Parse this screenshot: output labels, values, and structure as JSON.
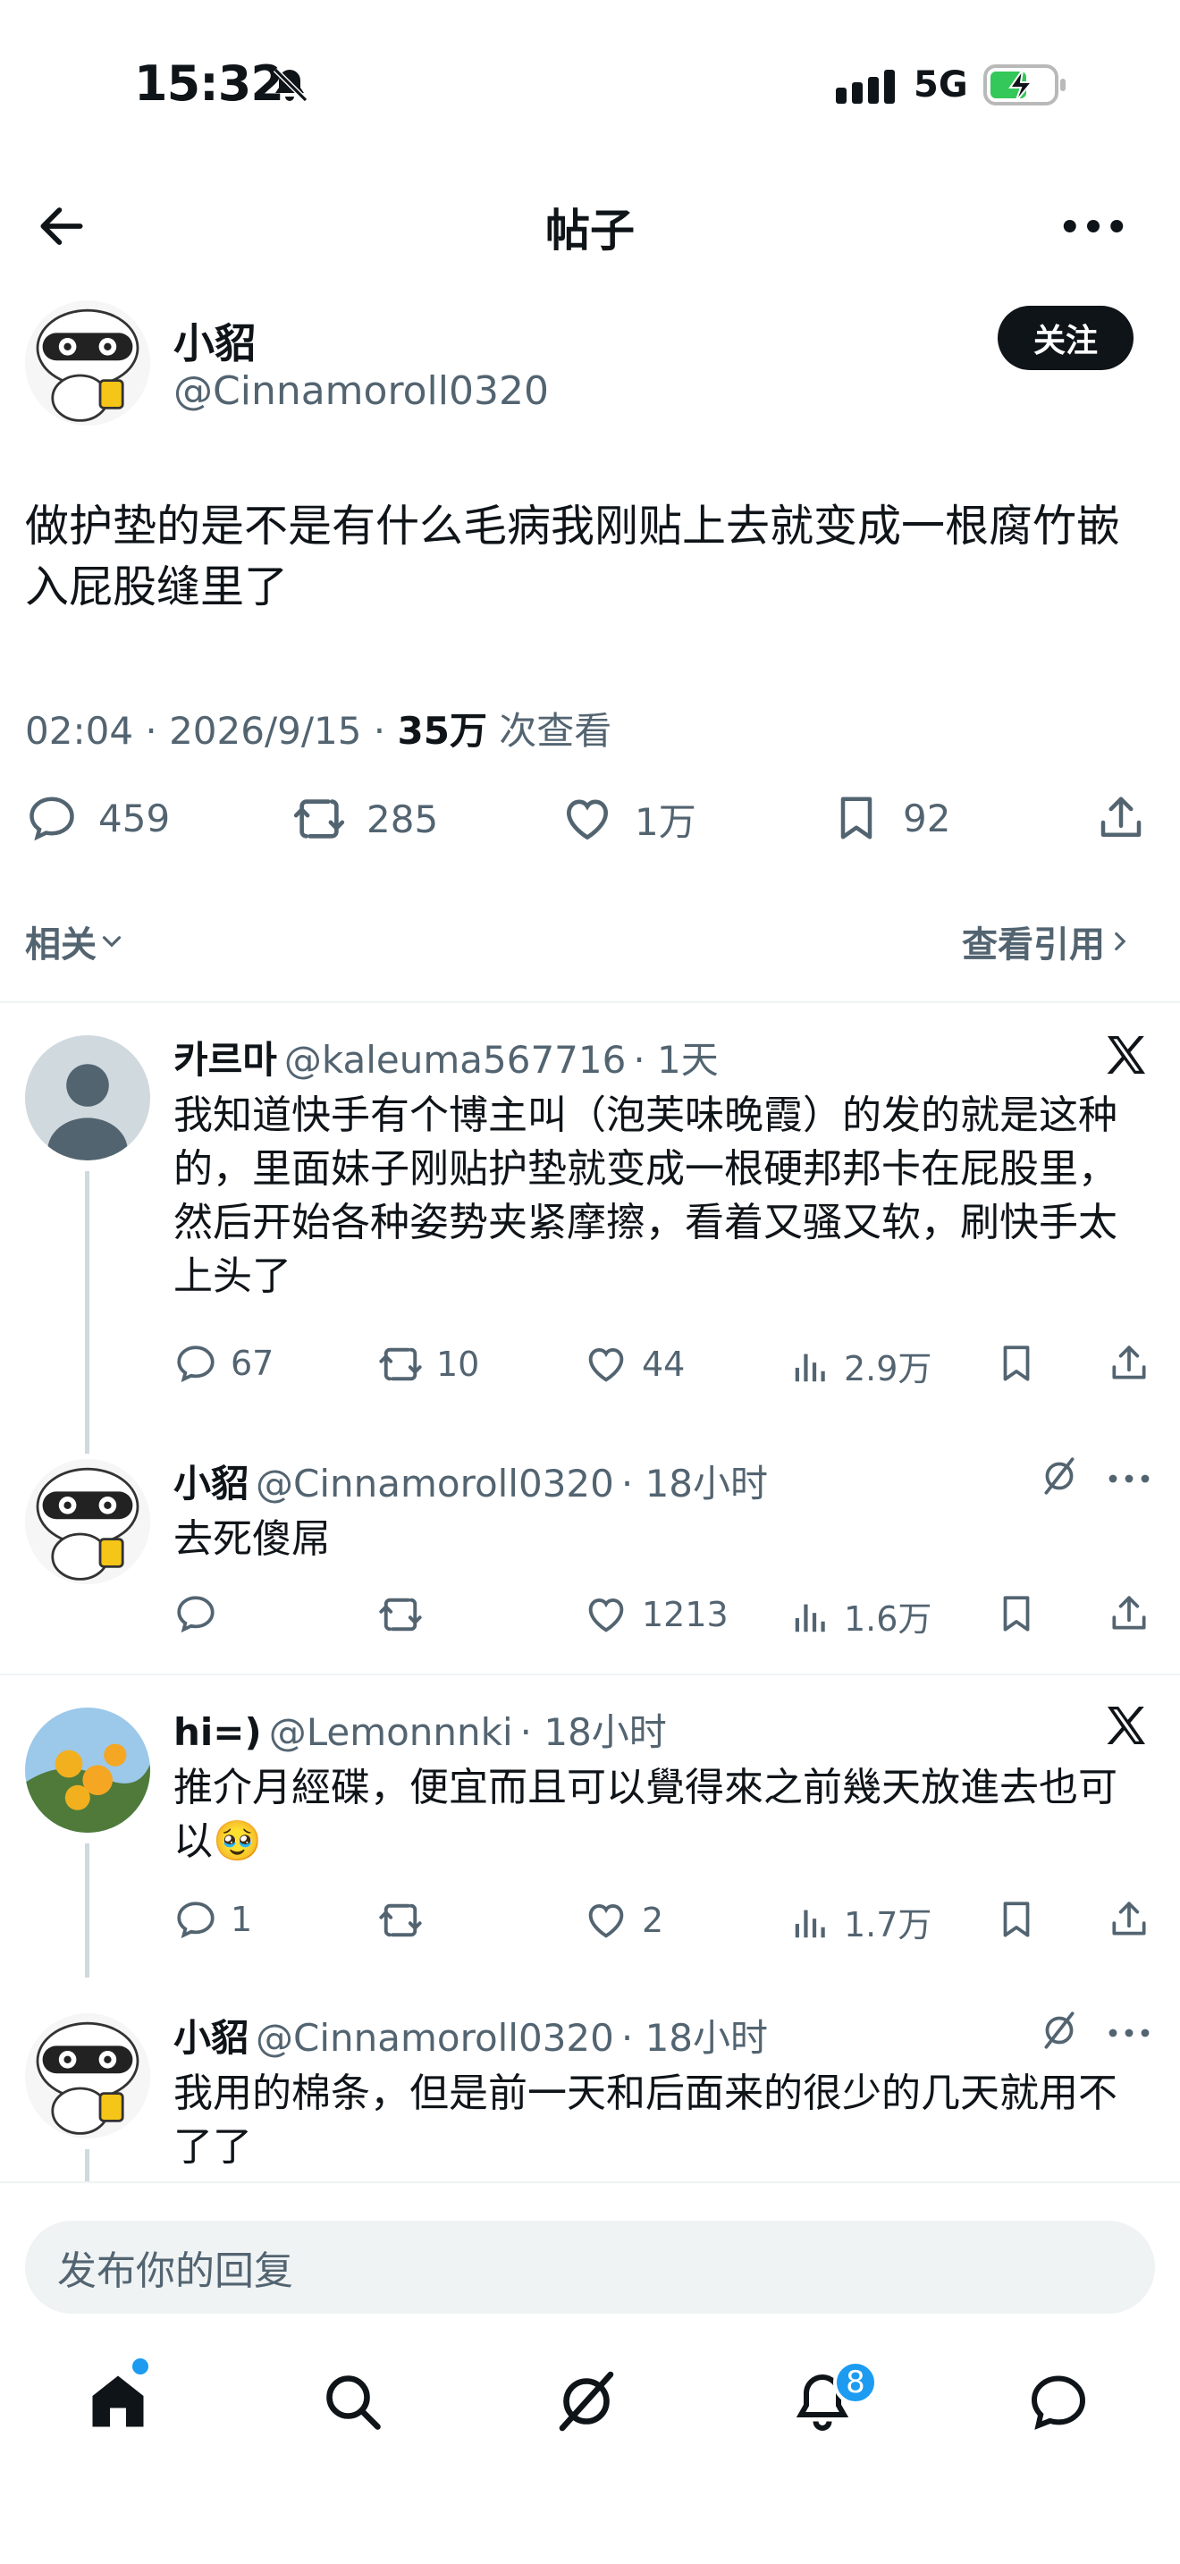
{
  "status_bar": {
    "time": "15:32",
    "network": "5G"
  },
  "header": {
    "title": "帖子"
  },
  "post": {
    "author_name": "小貂",
    "author_handle": "@Cinnamoroll0320",
    "follow_label": "关注",
    "text": "做护垫的是不是有什么毛病我刚贴上去就变成一根腐竹嵌入屁股缝里了",
    "meta_time": "02:04 · 2026/9/15 · ",
    "views_count": "35万",
    "views_label": " 次查看",
    "replies": "459",
    "reposts": "285",
    "likes": "1万",
    "bookmarks": "92",
    "related_label": "相关",
    "see_quotes_label": "查看引用"
  },
  "replies": [
    {
      "name": "카르마",
      "handle": "@kaleuma567716",
      "time": "· 1天",
      "text": "我知道快手有个博主叫（泡芙味晚霞）的发的就是这种的，里面妹子刚贴护垫就变成一根硬邦邦卡在屁股里，然后开始各种姿势夹紧摩擦，看着又骚又软，刷快手太上头了",
      "replies": "67",
      "reposts": "10",
      "likes": "44",
      "views": "2.9万"
    },
    {
      "name": "小貂",
      "handle": "@Cinnamoroll0320",
      "time": "· 18小时",
      "text": "去死傻屌",
      "replies": "",
      "reposts": "",
      "likes": "1213",
      "views": "1.6万"
    },
    {
      "name": "hi=)",
      "handle": "@Lemonnnki",
      "time": "· 18小时",
      "text": "推介月經碟，便宜而且可以覺得來之前幾天放進去也可以🥹",
      "replies": "1",
      "reposts": "",
      "likes": "2",
      "views": "1.7万"
    },
    {
      "name": "小貂",
      "handle": "@Cinnamoroll0320",
      "time": "· 18小时",
      "text": "我用的棉条，但是前一天和后面来的很少的几天就用不了了"
    }
  ],
  "composer": {
    "placeholder": "发布你的回复"
  },
  "tabbar": {
    "notifications_badge": "8"
  },
  "colors": {
    "accent": "#1d9bf0",
    "text": "#0f1419",
    "secondary": "#536471",
    "divider": "#eff3f4"
  }
}
